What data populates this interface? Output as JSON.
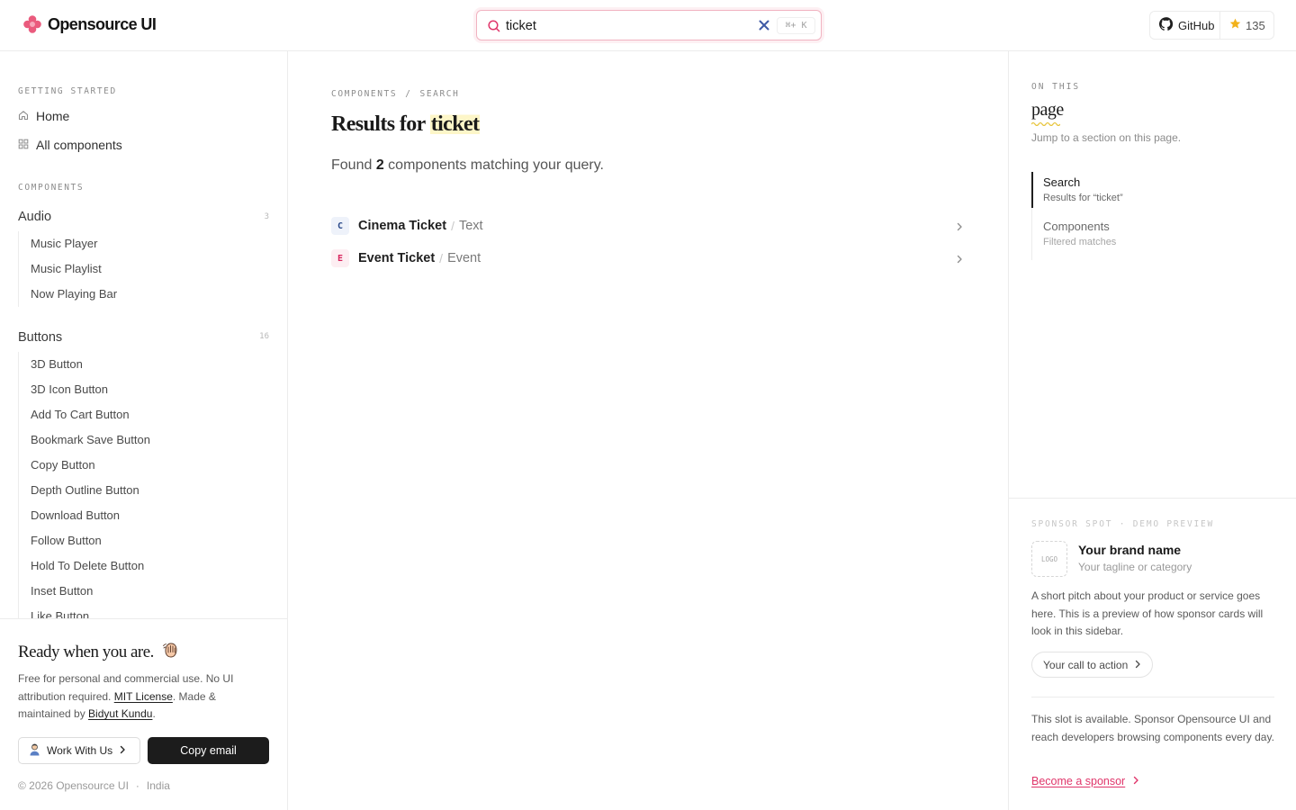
{
  "header": {
    "brand_name": "Opensource UI",
    "search": {
      "value": "ticket",
      "placeholder": "",
      "shortcut": "⌘+ K"
    },
    "github_label": "GitHub",
    "stars": "135"
  },
  "sidebar": {
    "getting_started_label": "GETTING STARTED",
    "links": [
      {
        "label": "Home",
        "icon": "home-icon"
      },
      {
        "label": "All components",
        "icon": "grid-icon"
      }
    ],
    "components_label": "COMPONENTS",
    "groups": [
      {
        "title": "Audio",
        "count": "3",
        "items": [
          "Music Player",
          "Music Playlist",
          "Now Playing Bar"
        ]
      },
      {
        "title": "Buttons",
        "count": "16",
        "items": [
          "3D Button",
          "3D Icon Button",
          "Add To Cart Button",
          "Bookmark Save Button",
          "Copy Button",
          "Depth Outline Button",
          "Download Button",
          "Follow Button",
          "Hold To Delete Button",
          "Inset Button",
          "Like Button"
        ]
      }
    ],
    "footer": {
      "title": "Ready when you are.",
      "text_1": "Free for personal and commercial use. No UI attribution required. ",
      "license_link": "MIT License",
      "text_2": ". Made & maintained by ",
      "author_link": "Bidyut Kundu",
      "text_3": ".",
      "work_button": "Work With Us",
      "copy_button": "Copy email",
      "copyright": "© 2026 Opensource UI",
      "separator": "·",
      "country": "India"
    }
  },
  "main": {
    "breadcrumb": [
      "COMPONENTS",
      "/",
      "SEARCH"
    ],
    "title_prefix": "Results for ",
    "title_query": "ticket",
    "found_prefix": "Found ",
    "found_count": "2",
    "found_suffix": " components matching your query.",
    "results": [
      {
        "badge": "C",
        "name": "Cinema Ticket",
        "separator": "/",
        "category": "Text",
        "badge_color": "#2b4a8a",
        "badge_bg": "#eef2fa"
      },
      {
        "badge": "E",
        "name": "Event Ticket",
        "separator": "/",
        "category": "Event",
        "badge_color": "#d8265f",
        "badge_bg": "#fdeef2"
      }
    ]
  },
  "toc": {
    "label": "ON THIS",
    "title": "page",
    "subtitle": "Jump to a section on this page.",
    "items": [
      {
        "title": "Search",
        "sub": "Results for “ticket”",
        "active": true
      },
      {
        "title": "Components",
        "sub": "Filtered matches",
        "active": false
      }
    ]
  },
  "sponsor": {
    "label": "SPONSOR SPOT · DEMO PREVIEW",
    "logo_text": "LOGO",
    "brand_name": "Your brand name",
    "tagline": "Your tagline or category",
    "pitch": "A short pitch about your product or service goes here. This is a preview of how sponsor cards will look in this sidebar.",
    "cta": "Your call to action",
    "available": "This slot is available. Sponsor Opensource UI and reach developers browsing components every day.",
    "become": "Become a sponsor"
  },
  "colors": {
    "accent": "#e0356a",
    "brand_logo": "#ea5b7d",
    "star": "#f2b21b",
    "highlight": "#fdf6c8"
  }
}
